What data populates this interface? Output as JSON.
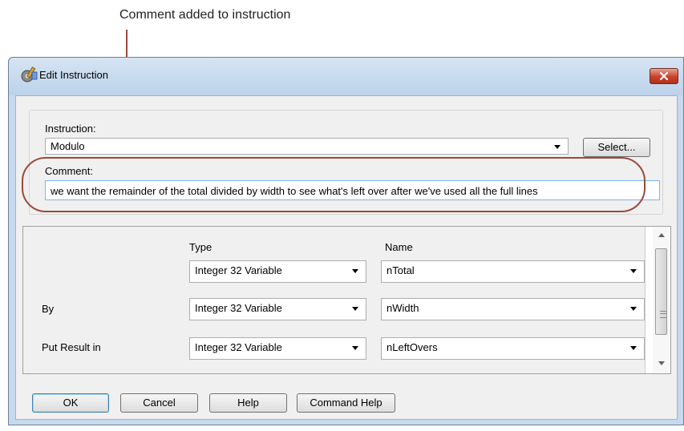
{
  "annotation": {
    "callout_text": "Comment added to instruction",
    "accent_color": "#9c4a3c"
  },
  "window": {
    "title": "Edit Instruction",
    "icon": "gear-tools-icon",
    "close_icon": "close-icon"
  },
  "instruction": {
    "label": "Instruction:",
    "value": "Modulo",
    "select_button": "Select..."
  },
  "comment": {
    "label": "Comment:",
    "value": "we want the remainder of the total divided by width to see what's left over after we've used all the full lines"
  },
  "params": {
    "type_header": "Type",
    "name_header": "Name",
    "rows": [
      {
        "label": "",
        "type": "Integer 32 Variable",
        "name": "nTotal"
      },
      {
        "label": "By",
        "type": "Integer 32 Variable",
        "name": "nWidth"
      },
      {
        "label": "Put Result in",
        "type": "Integer 32 Variable",
        "name": "nLeftOvers"
      }
    ]
  },
  "buttons": {
    "ok": "OK",
    "cancel": "Cancel",
    "help": "Help",
    "command_help": "Command Help"
  }
}
